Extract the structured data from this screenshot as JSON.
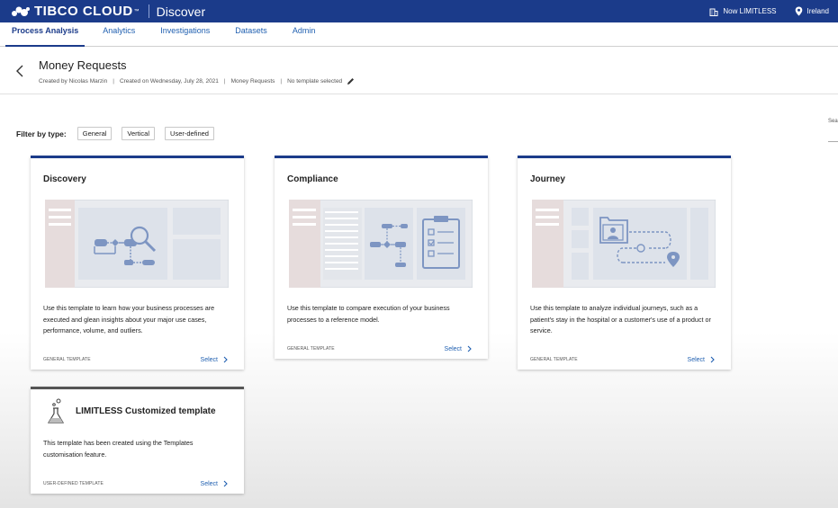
{
  "header": {
    "brand": "TIBCO CLOUD",
    "brand_tm": "™",
    "app": "Discover",
    "org": "Now LIMITLESS",
    "region": "Ireland"
  },
  "nav": {
    "tabs": [
      "Process Analysis",
      "Analytics",
      "Investigations",
      "Datasets",
      "Admin"
    ],
    "active": "Process Analysis"
  },
  "page": {
    "title": "Money Requests",
    "created_by": "Created by Nicolas Marzin",
    "created_on": "Created on Wednesday, July 28, 2021",
    "dataset": "Money Requests",
    "template": "No template selected"
  },
  "filter": {
    "label": "Filter by type:",
    "chips": [
      "General",
      "Vertical",
      "User-defined"
    ]
  },
  "edge": {
    "search_fragment": "Sea"
  },
  "cards": [
    {
      "title": "Discovery",
      "desc_lines": [
        "Use this template to learn how your business processes are",
        "executed and glean insights about your major use cases,",
        "performance, volume, and outliers."
      ],
      "type": "GENERAL TEMPLATE",
      "select": "Select"
    },
    {
      "title": "Compliance",
      "desc_lines": [
        "Use this template to compare execution of your business",
        "processes to a reference model."
      ],
      "type": "GENERAL TEMPLATE",
      "select": "Select"
    },
    {
      "title": "Journey",
      "desc_lines": [
        "Use this template to analyze individual journeys, such as a",
        "patient's stay in the hospital or a customer's use of a product or",
        "service."
      ],
      "type": "GENERAL TEMPLATE",
      "select": "Select"
    },
    {
      "title": "LIMITLESS Customized template",
      "desc_lines": [
        "This template has been created using the Templates",
        "customisation feature."
      ],
      "type": "USER-DEFINED TEMPLATE",
      "select": "Select"
    }
  ],
  "colors": {
    "header_bg": "#1b3b8a",
    "link": "#1f5fb0",
    "illus_bg": "#e9ebef",
    "illus_panel": "#dde2ea",
    "illus_sidebar": "#e6dcdc",
    "illus_shape": "#7d95c2"
  },
  "icons": [
    "tibco-logo-icon",
    "building-icon",
    "location-pin-icon",
    "back-chevron-icon",
    "pencil-icon",
    "chevron-right-icon",
    "flask-icon"
  ]
}
